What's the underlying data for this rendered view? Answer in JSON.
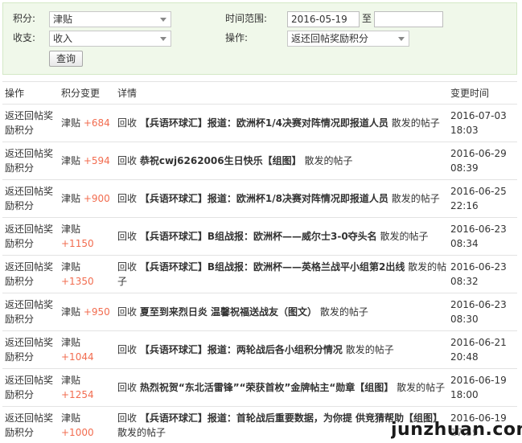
{
  "filter": {
    "points_label": "积分:",
    "points_value": "津贴",
    "income_label": "收支:",
    "income_value": "收入",
    "time_label": "时间范围:",
    "date_from": "2016-05-19",
    "date_separator": "至",
    "date_to": "",
    "operation_label": "操作:",
    "operation_value": "返还回帖奖励积分",
    "query_button": "查询"
  },
  "table": {
    "headers": {
      "op": "操作",
      "change": "积分变更",
      "detail": "详情",
      "time": "变更时间"
    },
    "rows": [
      {
        "op": "返还回帖奖励积分",
        "credit": "津贴",
        "amount": "+684",
        "recover": "回收",
        "title": "【兵语环球汇】报道：欧洲杯1/4决赛对阵情况即报道人员",
        "suffix": "散发的帖子",
        "date": "2016-07-03",
        "time": "18:03"
      },
      {
        "op": "返还回帖奖励积分",
        "credit": "津贴",
        "amount": "+594",
        "recover": "回收",
        "title": "恭祝cwj6262006生日快乐【组图】",
        "suffix": "散发的帖子",
        "date": "2016-06-29",
        "time": "08:39"
      },
      {
        "op": "返还回帖奖励积分",
        "credit": "津贴",
        "amount": "+900",
        "recover": "回收",
        "title": "【兵语环球汇】报道：欧洲杯1/8决赛对阵情况即报道人员",
        "suffix": "散发的帖子",
        "date": "2016-06-25",
        "time": "22:16"
      },
      {
        "op": "返还回帖奖励积分",
        "credit": "津贴",
        "amount": "+1150",
        "recover": "回收",
        "title": "【兵语环球汇】B组战报：欧洲杯——威尔士3-0夺头名",
        "suffix": "散发的帖子",
        "date": "2016-06-23",
        "time": "08:34"
      },
      {
        "op": "返还回帖奖励积分",
        "credit": "津贴",
        "amount": "+1350",
        "recover": "回收",
        "title": "【兵语环球汇】B组战报：欧洲杯——英格兰战平小组第2出线",
        "suffix": "散发的帖子",
        "date": "2016-06-23",
        "time": "08:32"
      },
      {
        "op": "返还回帖奖励积分",
        "credit": "津贴",
        "amount": "+950",
        "recover": "回收",
        "title": "夏至到来烈日炎 温馨祝福送战友（图文）",
        "suffix": "散发的帖子",
        "date": "2016-06-23",
        "time": "08:30"
      },
      {
        "op": "返还回帖奖励积分",
        "credit": "津贴",
        "amount": "+1044",
        "recover": "回收",
        "title": "【兵语环球汇】报道：两轮战后各小组积分情况",
        "suffix": "散发的帖子",
        "date": "2016-06-21",
        "time": "20:48"
      },
      {
        "op": "返还回帖奖励积分",
        "credit": "津贴",
        "amount": "+1254",
        "recover": "回收",
        "title": "热烈祝贺“东北活雷锋”“荣获首枚”金牌帖主“勋章【组图】",
        "suffix": "散发的帖子",
        "date": "2016-06-19",
        "time": "18:00"
      },
      {
        "op": "返还回帖奖励积分",
        "credit": "津贴",
        "amount": "+1000",
        "recover": "回收",
        "title": "【兵语环球汇】报道：首轮战后重要数据，为你提 供竞猜帮助【组图】",
        "suffix": "散发的帖子",
        "date": "2016-06-19",
        "time": "17:59"
      }
    ]
  },
  "watermark": "junzhuan.com"
}
